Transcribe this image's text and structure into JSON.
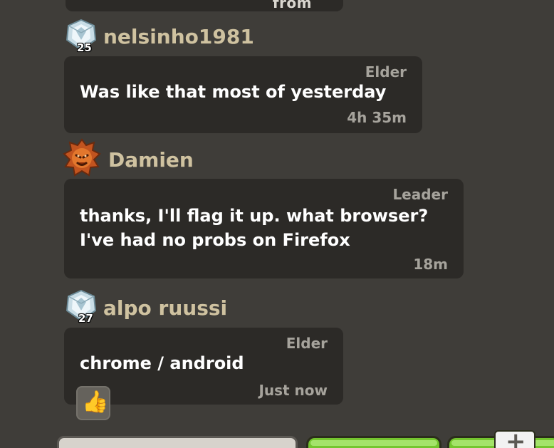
{
  "chat": {
    "partial_top_text": "from",
    "messages": [
      {
        "username": "nelsinho1981",
        "level": "25",
        "role": "Elder",
        "text": "Was like that most of yesterday",
        "time": "4h 35m",
        "badge_icon": "crystal-league-badge-icon"
      },
      {
        "username": "Damien",
        "role": "Leader",
        "text": "thanks, I'll flag it up. what browser?\nI've had no probs on Firefox",
        "time": "18m",
        "badge_icon": "champion-league-badge-icon"
      },
      {
        "username": "alpo ruussi",
        "level": "27",
        "role": "Elder",
        "text": "chrome / android",
        "time": "Just now",
        "badge_icon": "crystal-league-badge-icon",
        "reaction": "👍"
      }
    ]
  },
  "bottom_bar": {
    "plus_label": "+"
  },
  "colors": {
    "background": "#3f3d39",
    "bubble": "#2c2a27",
    "username": "#cfc2a0",
    "meta": "#a6a39c",
    "accent_green": "#74c52f"
  }
}
